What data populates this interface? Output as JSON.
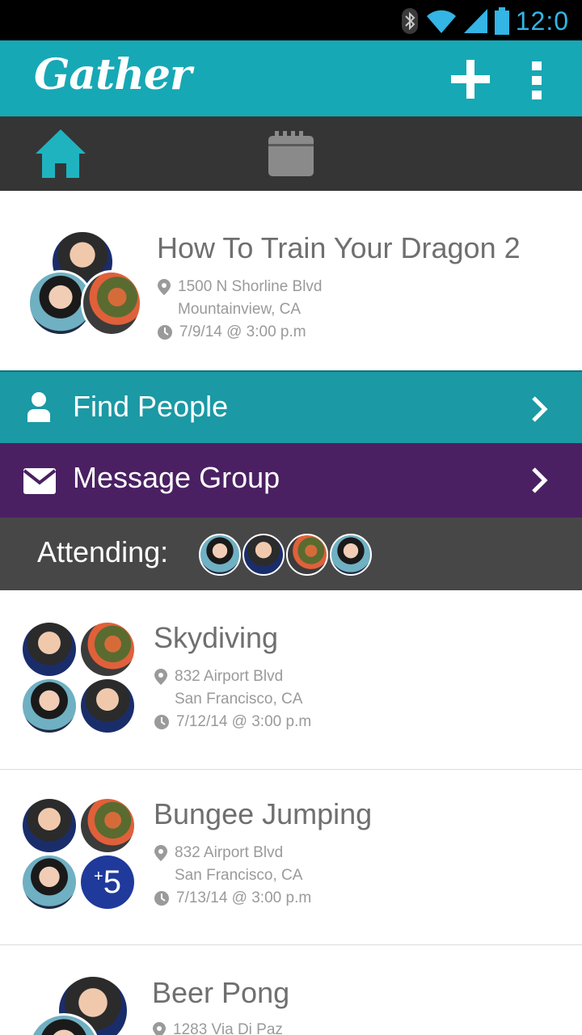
{
  "status_bar": {
    "time": "12:0",
    "icons": [
      "bluetooth-icon",
      "wifi-icon",
      "signal-icon",
      "battery-icon"
    ]
  },
  "app_bar": {
    "logo": "Gather",
    "actions": [
      "add-icon",
      "more-vert-icon"
    ]
  },
  "tabs": [
    {
      "name": "home",
      "icon": "home-icon",
      "active": true
    },
    {
      "name": "calendar",
      "icon": "calendar-icon",
      "active": false
    }
  ],
  "featured_event": {
    "title": "How To Train Your Dragon 2",
    "address_line1": "1500 N Shorline Blvd",
    "address_line2": "Mountainview, CA",
    "datetime": "7/9/14 @ 3:00 p.m"
  },
  "actions": {
    "find_people": "Find People",
    "message_group": "Message Group"
  },
  "attending": {
    "label": "Attending:"
  },
  "events": [
    {
      "title": "Skydiving",
      "address_line1": "832 Airport Blvd",
      "address_line2": "San Francisco, CA",
      "datetime": "7/12/14 @ 3:00 p.m"
    },
    {
      "title": "Bungee Jumping",
      "address_line1": "832 Airport Blvd",
      "address_line2": "San Francisco, CA",
      "datetime": "7/13/14 @ 3:00 p.m",
      "extra_count": "5",
      "extra_prefix": "+"
    },
    {
      "title": "Beer Pong",
      "address_line1": "1283 Via Di Paz"
    }
  ],
  "colors": {
    "teal": "#17a8b5",
    "purple": "#4a2062",
    "dark": "#353535",
    "status_blue": "#33b5e5"
  }
}
